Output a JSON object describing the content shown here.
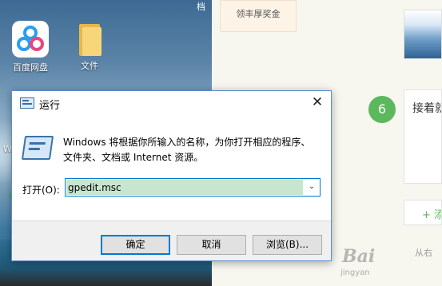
{
  "desktop": {
    "top_text": "档",
    "icons": [
      {
        "label": "百度网盘",
        "icon": "baidu-netdisk-icon"
      },
      {
        "label": "文件",
        "icon": "folder-icon"
      }
    ],
    "edge_label": "W"
  },
  "webpage": {
    "reward_lines": [
      "领丰厚奖金"
    ],
    "step_number": "6",
    "step_text": "接着就",
    "add_label": "+ 添",
    "from_text": "从右",
    "watermark": "Bai",
    "watermark_sub": "jingyan"
  },
  "run_dialog": {
    "title": "运行",
    "close_icon": "close-icon",
    "description_line1": "Windows 将根据你所输入的名称，为你打开相应的程序、",
    "description_line2": "文件夹、文档或 Internet 资源。",
    "open_label": "打开(O):",
    "open_value": "gpedit.msc",
    "buttons": {
      "ok": "确定",
      "cancel": "取消",
      "browse": "浏览(B)..."
    }
  },
  "colors": {
    "accent": "#0078d7",
    "selection": "#c8e6cf",
    "step_badge": "#5cb85c"
  }
}
